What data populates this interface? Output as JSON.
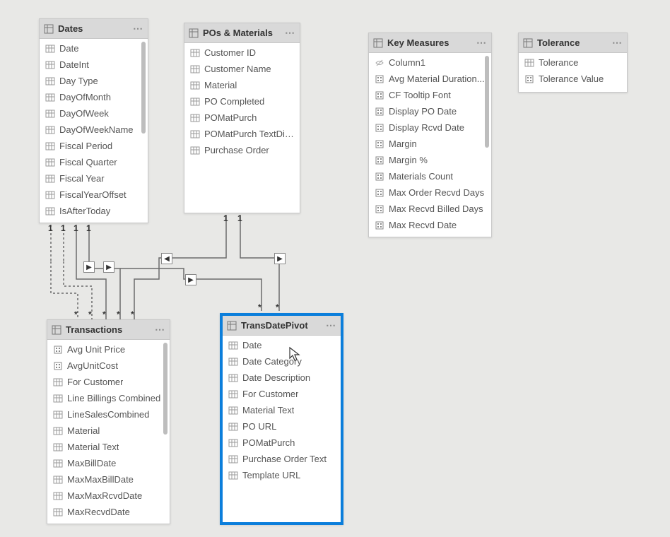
{
  "tables": {
    "dates": {
      "title": "Dates",
      "fields": [
        {
          "icon": "col",
          "label": "Date"
        },
        {
          "icon": "col",
          "label": "DateInt"
        },
        {
          "icon": "col",
          "label": "Day Type"
        },
        {
          "icon": "col",
          "label": "DayOfMonth"
        },
        {
          "icon": "col",
          "label": "DayOfWeek"
        },
        {
          "icon": "col",
          "label": "DayOfWeekName"
        },
        {
          "icon": "col",
          "label": "Fiscal Period"
        },
        {
          "icon": "col",
          "label": "Fiscal Quarter"
        },
        {
          "icon": "col",
          "label": "Fiscal Year"
        },
        {
          "icon": "col",
          "label": "FiscalYearOffset"
        },
        {
          "icon": "col",
          "label": "IsAfterToday"
        }
      ]
    },
    "pos": {
      "title": "POs & Materials",
      "fields": [
        {
          "icon": "col",
          "label": "Customer ID"
        },
        {
          "icon": "col",
          "label": "Customer Name"
        },
        {
          "icon": "col",
          "label": "Material"
        },
        {
          "icon": "col",
          "label": "PO Completed"
        },
        {
          "icon": "col",
          "label": "POMatPurch"
        },
        {
          "icon": "col",
          "label": "POMatPurch TextDisp"
        },
        {
          "icon": "col",
          "label": "Purchase Order"
        }
      ]
    },
    "measures": {
      "title": "Key Measures",
      "fields": [
        {
          "icon": "hidden",
          "label": "Column1"
        },
        {
          "icon": "measure",
          "label": "Avg Material Duration..."
        },
        {
          "icon": "measure",
          "label": "CF Tooltip Font"
        },
        {
          "icon": "measure",
          "label": "Display PO Date"
        },
        {
          "icon": "measure",
          "label": "Display Rcvd Date"
        },
        {
          "icon": "measure",
          "label": "Margin"
        },
        {
          "icon": "measure",
          "label": "Margin %"
        },
        {
          "icon": "measure",
          "label": "Materials Count"
        },
        {
          "icon": "measure",
          "label": "Max Order Recvd Days"
        },
        {
          "icon": "measure",
          "label": "Max Recvd Billed Days"
        },
        {
          "icon": "measure",
          "label": "Max Recvd Date"
        }
      ]
    },
    "tolerance": {
      "title": "Tolerance",
      "fields": [
        {
          "icon": "col",
          "label": "Tolerance"
        },
        {
          "icon": "measure",
          "label": "Tolerance Value"
        }
      ]
    },
    "transactions": {
      "title": "Transactions",
      "fields": [
        {
          "icon": "measure",
          "label": "Avg Unit Price"
        },
        {
          "icon": "measure",
          "label": "AvgUnitCost"
        },
        {
          "icon": "col",
          "label": "For Customer"
        },
        {
          "icon": "col",
          "label": "Line Billings Combined"
        },
        {
          "icon": "col",
          "label": "LineSalesCombined"
        },
        {
          "icon": "col",
          "label": "Material"
        },
        {
          "icon": "col",
          "label": "Material Text"
        },
        {
          "icon": "col",
          "label": "MaxBillDate"
        },
        {
          "icon": "col",
          "label": "MaxMaxBillDate"
        },
        {
          "icon": "col",
          "label": "MaxMaxRcvdDate"
        },
        {
          "icon": "col",
          "label": "MaxRecvdDate"
        }
      ]
    },
    "pivot": {
      "title": "TransDatePivot",
      "fields": [
        {
          "icon": "col",
          "label": "Date"
        },
        {
          "icon": "col",
          "label": "Date Category"
        },
        {
          "icon": "col",
          "label": "Date Description"
        },
        {
          "icon": "col",
          "label": "For Customer"
        },
        {
          "icon": "col",
          "label": "Material Text"
        },
        {
          "icon": "col",
          "label": "PO URL"
        },
        {
          "icon": "col",
          "label": "POMatPurch"
        },
        {
          "icon": "col",
          "label": "Purchase Order Text"
        },
        {
          "icon": "col",
          "label": "Template URL"
        }
      ]
    }
  },
  "relationships": {
    "one": "1",
    "many": "*"
  },
  "ellipsis": "⋯"
}
